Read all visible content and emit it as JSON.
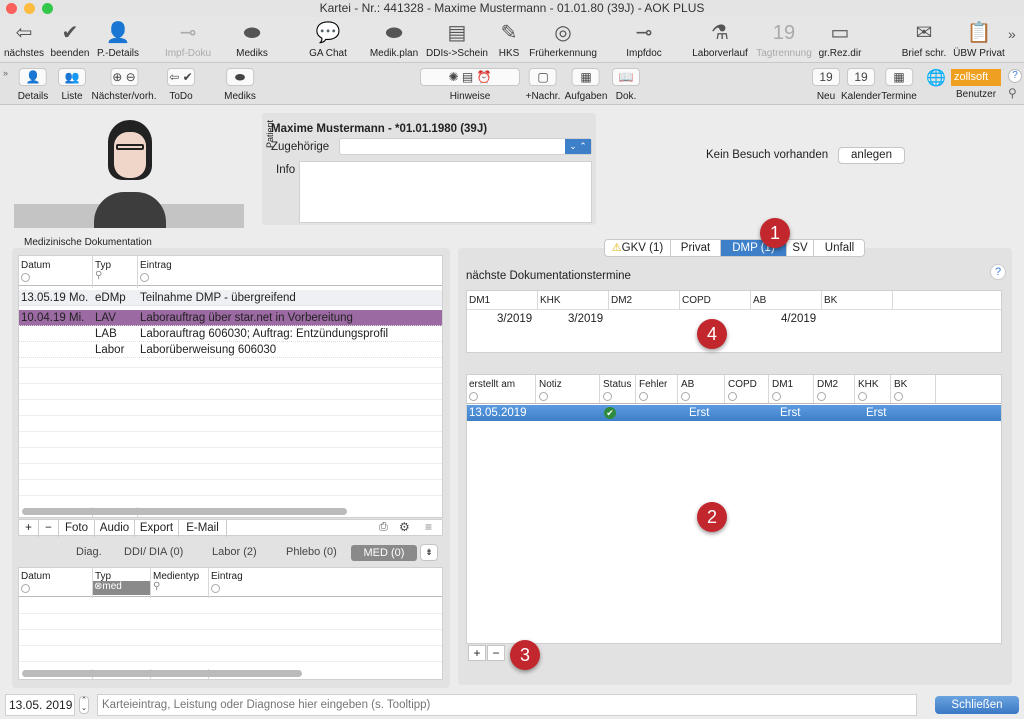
{
  "window": {
    "title": "Kartei - Nr.: 441328 - Maxime Mustermann - 01.01.80 (39J) - AOK PLUS"
  },
  "toolbar1": [
    {
      "label": "nächstes",
      "icon": "arrow-left-circle-icon",
      "glyph": "⇦"
    },
    {
      "label": "beenden",
      "icon": "check-circle-icon",
      "glyph": "✔"
    },
    {
      "label": "P.-Details",
      "icon": "person-icon",
      "glyph": "👤"
    },
    {
      "label": "Impf-Doku",
      "icon": "syringe-icon",
      "glyph": "⊸",
      "dim": true
    },
    {
      "label": "Mediks",
      "icon": "pill-icon",
      "glyph": "⬬"
    },
    {
      "label": "GA Chat",
      "icon": "chat-icon",
      "glyph": "💬"
    },
    {
      "label": "Medik.plan",
      "icon": "pill-icon",
      "glyph": "⬬"
    },
    {
      "label": "DDIs->Schein",
      "icon": "documents-icon",
      "glyph": "▤"
    },
    {
      "label": "HKS",
      "icon": "document-edit-icon",
      "glyph": "✎"
    },
    {
      "label": "Früherkennung",
      "icon": "radar-icon",
      "glyph": "◎"
    },
    {
      "label": "Impfdoc",
      "icon": "syringe-icon",
      "glyph": "⊸"
    },
    {
      "label": "Laborverlauf",
      "icon": "flask-icon",
      "glyph": "⚗"
    },
    {
      "label": "Tagtrennung",
      "icon": "calendar-icon",
      "glyph": "19",
      "dim": true
    },
    {
      "label": "gr.Rez.dir",
      "icon": "prescription-icon",
      "glyph": "▭"
    },
    {
      "label": "Brief schr.",
      "icon": "letter-add-icon",
      "glyph": "✉"
    },
    {
      "label": "ÜBW Privat",
      "icon": "clipboard-add-icon",
      "glyph": "📋"
    }
  ],
  "toolbar1_more": "»",
  "toolbar2": [
    {
      "label": "Details",
      "icon": "person-icon",
      "glyph": "👤"
    },
    {
      "label": "Liste",
      "icon": "persons-add-icon",
      "glyph": "👥"
    },
    {
      "label": "Nächster/vorh.",
      "icon": "plus-minus-icon",
      "glyph": "⊕ ⊖"
    },
    {
      "label": "ToDo",
      "icon": "todo-icon",
      "glyph": "⇦ ✔"
    },
    {
      "label": "Mediks",
      "icon": "pill-icon",
      "glyph": "⬬"
    },
    {
      "label": "Hinweise",
      "icon": "alerts-icon",
      "glyph": "✺ ▤ ⏰"
    },
    {
      "label": "+Nachr.",
      "icon": "message-icon",
      "glyph": "▢"
    },
    {
      "label": "Aufgaben",
      "icon": "tasks-icon",
      "glyph": "▦"
    },
    {
      "label": "Dok.",
      "icon": "book-icon",
      "glyph": "📖"
    },
    {
      "label": "Neu",
      "icon": "calendar-add-icon",
      "glyph": "19"
    },
    {
      "label": "Kalender",
      "icon": "calendar-icon",
      "glyph": "19"
    },
    {
      "label": "Termine",
      "icon": "calendar-list-icon",
      "glyph": "▦"
    }
  ],
  "user": {
    "name": "zollsoft",
    "label": "Benutzer"
  },
  "patient": {
    "section_label": "Patient",
    "name": "Maxime Mustermann - *01.01.1980 (39J)",
    "relatives_label": "Zugehörige",
    "relatives_value": "",
    "info_label": "Info",
    "info_value": ""
  },
  "visit": {
    "status": "Kein Besuch vorhanden",
    "button": "anlegen"
  },
  "med_doc": {
    "title": "Medizinische Dokumentation",
    "columns": [
      "Datum",
      "Typ",
      "Eintrag"
    ],
    "rows": [
      {
        "date": "13.05.19",
        "day": "Mo.",
        "type": "eDMp",
        "entry": "Teilnahme DMP - übergreifend"
      },
      {
        "date": "10.04.19",
        "day": "Mi.",
        "type": "LAV",
        "entry": "Laborauftrag über star.net in Vorbereitung",
        "highlight": "#9c6aa3"
      },
      {
        "date": "",
        "day": "",
        "type": "LAB",
        "entry": "Laborauftrag 606030; Auftrag:  Entzündungsprofil"
      },
      {
        "date": "",
        "day": "",
        "type": "Labor",
        "entry": "Laborüberweisung 606030"
      }
    ],
    "toolbar": [
      "+",
      "−",
      "Foto",
      "Audio",
      "Export",
      "E-Mail"
    ]
  },
  "sub_tabs": [
    {
      "label": "Diag."
    },
    {
      "label": "DDI/ DIA (0)"
    },
    {
      "label": "Labor (2)"
    },
    {
      "label": "Phlebo (0)"
    },
    {
      "label": "MED (0)",
      "active": true
    }
  ],
  "lower_table": {
    "columns": [
      "Datum",
      "Typ",
      "Medientyp",
      "Eintrag"
    ],
    "typ_filter": "med"
  },
  "billing_tabs": [
    {
      "label": "GKV (1)",
      "warning": true
    },
    {
      "label": "Privat"
    },
    {
      "label": "DMP (1)",
      "active": true
    },
    {
      "label": "SV"
    },
    {
      "label": "Unfall"
    }
  ],
  "dmp": {
    "next_title": "nächste Dokumentationstermine",
    "next_columns": [
      "DM1",
      "KHK",
      "DM2",
      "COPD",
      "AB",
      "BK"
    ],
    "next_values": [
      "3/2019",
      "3/2019",
      "",
      "",
      "4/2019",
      ""
    ],
    "columns": [
      "erstellt am",
      "Notiz",
      "Status",
      "Fehler",
      "AB",
      "COPD",
      "DM1",
      "DM2",
      "KHK",
      "BK"
    ],
    "rows": [
      {
        "cells": [
          "13.05.2019",
          "",
          "ok",
          "",
          "Erst",
          "",
          "Erst",
          "",
          "Erst",
          ""
        ]
      }
    ],
    "add": "+",
    "remove": "−"
  },
  "badges": [
    "1",
    "2",
    "3",
    "4"
  ],
  "footer": {
    "date": "13.05. 2019",
    "input_placeholder": "Karteieintrag, Leistung oder Diagnose hier eingeben (s. Tooltipp)",
    "close": "Schließen"
  },
  "colors": {
    "selection": "#3d7fc9",
    "highlight": "#9c6aa3",
    "badge": "#c1272d",
    "status_ok": "#2e8b3e",
    "user_badge": "#f0a020"
  }
}
